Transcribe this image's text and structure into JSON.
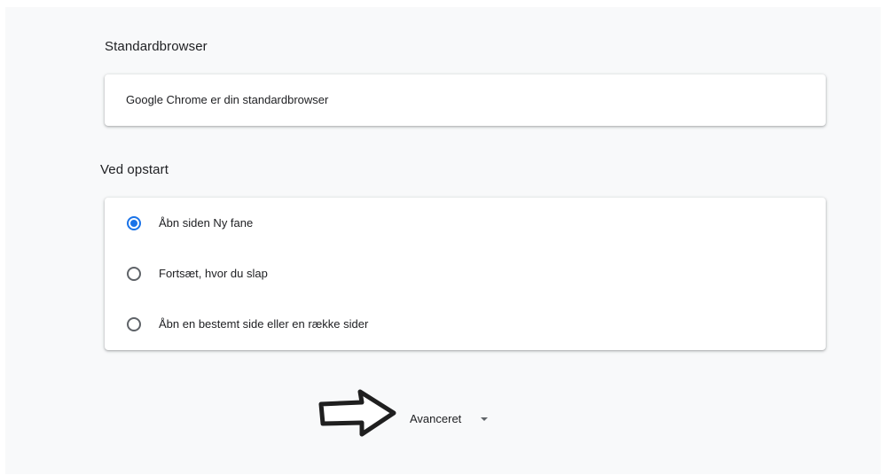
{
  "default_browser": {
    "section_title": "Standardbrowser",
    "status_text": "Google Chrome er din standardbrowser"
  },
  "on_startup": {
    "section_title": "Ved opstart",
    "options": [
      {
        "label": "Åbn siden Ny fane",
        "selected": true
      },
      {
        "label": "Fortsæt, hvor du slap",
        "selected": false
      },
      {
        "label": "Åbn en bestemt side eller en række sider",
        "selected": false
      }
    ]
  },
  "advanced": {
    "label": "Avanceret",
    "icon": "chevron-down-icon"
  },
  "annotation": {
    "icon": "arrow-right-icon"
  },
  "colors": {
    "accent": "#1a73e8",
    "background": "#f8f9fa",
    "card": "#ffffff",
    "text": "#202124"
  }
}
